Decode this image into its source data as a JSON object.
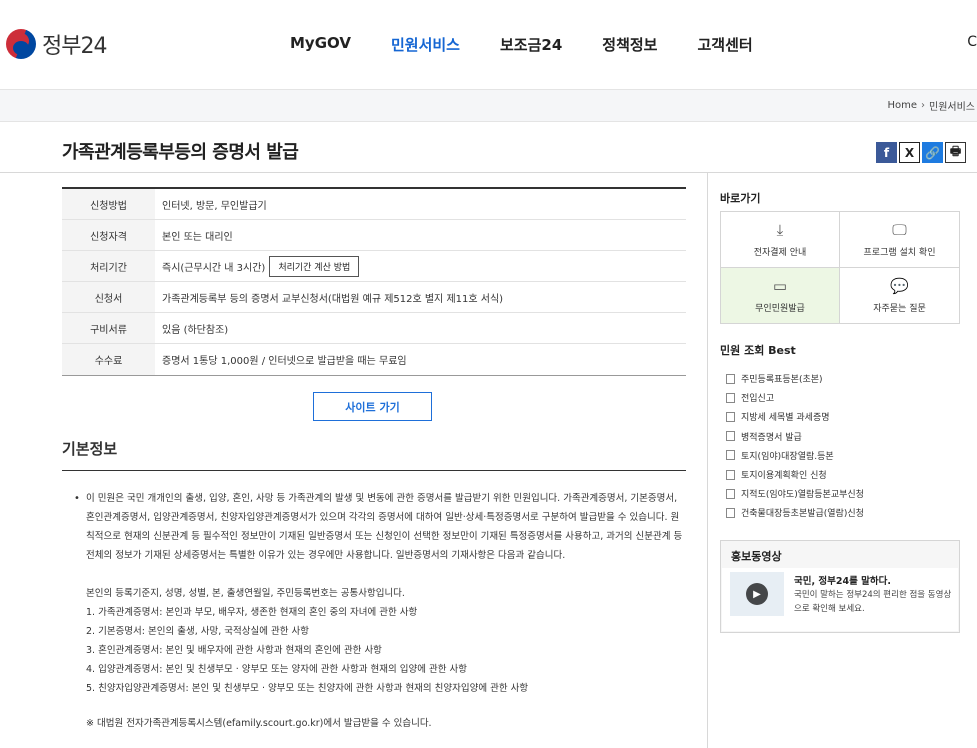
{
  "header": {
    "logo_text": "정부24",
    "nav": [
      "MyGOV",
      "민원서비스",
      "보조금24",
      "정책정보",
      "고객센터"
    ],
    "active_nav": "민원서비스",
    "edge_char": "C"
  },
  "breadcrumb": [
    "Home",
    "민원서비스"
  ],
  "page_title": "가족관계등록부등의 증명서 발급",
  "share": {
    "facebook": "f",
    "x": "X",
    "link": "🔗",
    "print": "🖶"
  },
  "info_rows": [
    {
      "label": "신청방법",
      "value": "인터넷, 방문, 무인발급기"
    },
    {
      "label": "신청자격",
      "value": "본인 또는 대리인"
    },
    {
      "label": "처리기간",
      "value": "즉시(근무시간 내 3시간)",
      "button": "처리기간 계산 방법"
    },
    {
      "label": "신청서",
      "value": "가족관계등록부 등의 증명서 교부신청서(대법원 예규 제512호 별지 제11호 서식)"
    },
    {
      "label": "구비서류",
      "value": "있음 (하단참조)"
    },
    {
      "label": "수수료",
      "value": "증명서 1통당 1,000원 / 인터넷으로 발급받을 때는 무료임"
    }
  ],
  "site_button": "사이트 가기",
  "basic": {
    "title": "기본정보",
    "bullet": "•",
    "para": "이 민원은 국민 개개인의 출생, 입양, 혼인, 사망 등 가족관계의 발생 및 변동에 관한 증명서를 발급받기 위한 민원입니다. 가족관계증명서, 기본증명서, 혼인관계증명서, 입양관계증명서, 친양자입양관계증명서가 있으며 각각의 증명서에 대하여 일반·상세·특정증명서로 구분하여 발급받을 수 있습니다. 원칙적으로 현재의 신분관계 등 필수적인 정보만이 기재된 일반증명서 또는 신청인이 선택한 정보만이 기재된 특정증명서를 사용하고, 과거의 신분관계 등 전체의 정보가 기재된 상세증명서는 특별한 이유가 있는 경우에만 사용합니다. 일반증명서의 기재사항은 다음과 같습니다.",
    "common": "본인의 등록기준지, 성명, 성별, 본, 출생연월일, 주민등록번호는 공통사항입니다.",
    "items": [
      "1. 가족관계증명서: 본인과 부모, 배우자, 생존한 현재의 혼인 중의 자녀에 관한 사항",
      "2. 기본증명서: 본인의 출생, 사망, 국적상실에 관한 사항",
      "3. 혼인관계증명서: 본인 및 배우자에 관한 사항과 현재의 혼인에 관한 사항",
      "4. 입양관계증명서: 본인 및 친생부모 · 양부모 또는 양자에 관한 사항과 현재의 입양에 관한 사항",
      "5. 친양자입양관계증명서: 본인 및 친생부모 · 양부모 또는 친양자에 관한 사항과 현재의 친양자입양에 관한 사항"
    ],
    "note": "※ 대법원 전자가족관계등록시스템(efamily.scourt.go.kr)에서 발급받을 수 있습니다."
  },
  "sidebar": {
    "quick_title": "바로가기",
    "quick": [
      {
        "label": "전자결제 안내",
        "icon": "⤓",
        "icon_name": "download-icon"
      },
      {
        "label": "프로그램 설치 확인",
        "icon": "🖵",
        "icon_name": "monitor-check-icon"
      },
      {
        "label": "무인민원발급",
        "icon": "▭",
        "icon_name": "kiosk-icon"
      },
      {
        "label": "자주묻는 질문",
        "icon": "💬",
        "icon_name": "faq-chat-icon"
      }
    ],
    "best_title": "민원 조회 Best",
    "best": [
      "주민등록표등본(초본)",
      "전입신고",
      "지방세 세목별 과세증명",
      "병적증명서 발급",
      "토지(임야)대장열람.등본",
      "토지이용계획확인 신청",
      "지적도(임야도)열람등본교부신청",
      "건축물대장등초본발급(열람)신청"
    ],
    "promo_title": "홍보동영상",
    "promo_head": "국민, 정부24를 말하다.",
    "promo_desc": "국민이 말하는 정부24의 편리한 점을 동영상으로 확인해 보세요.",
    "promo_play": "▶"
  }
}
